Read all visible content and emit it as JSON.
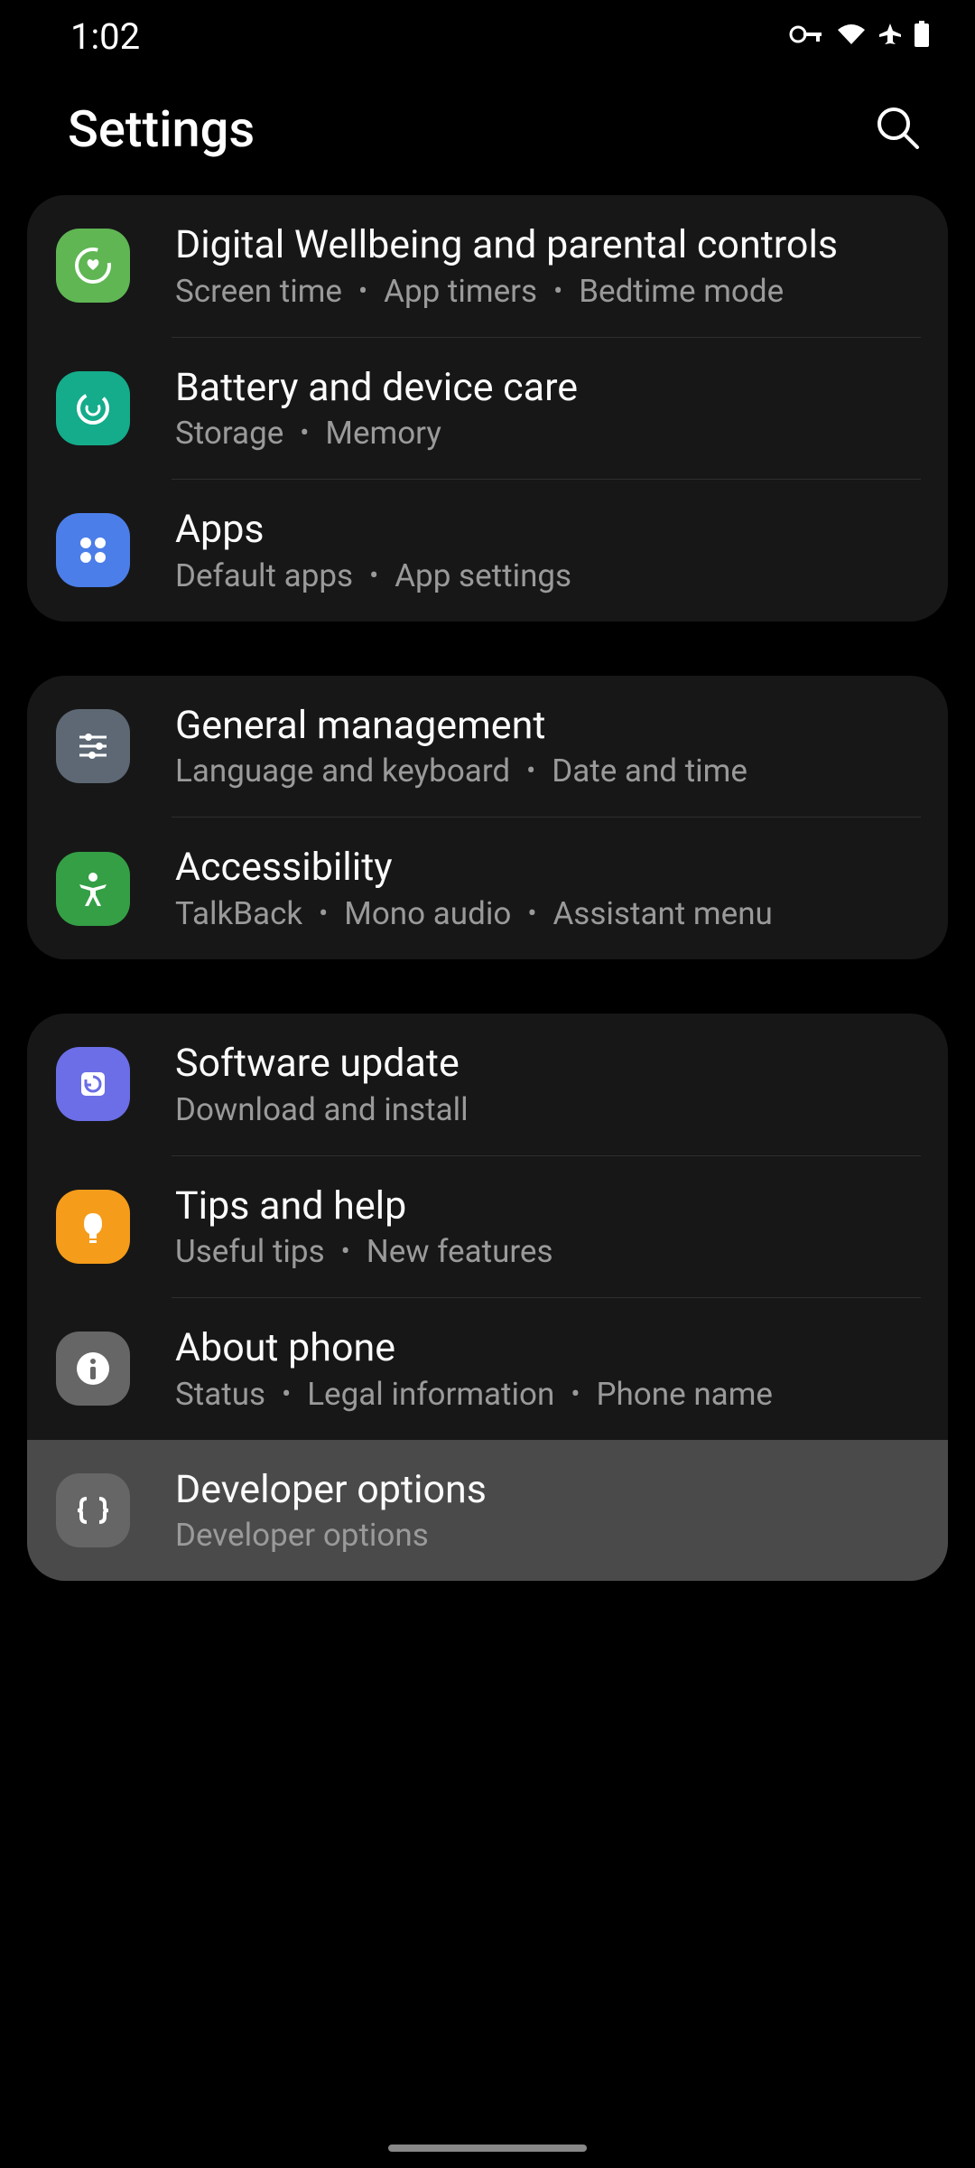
{
  "status": {
    "time": "1:02"
  },
  "header": {
    "title": "Settings"
  },
  "groups": [
    {
      "items": [
        {
          "id": "wellbeing",
          "title": "Digital Wellbeing and parental controls",
          "subs": [
            "Screen time",
            "App timers",
            "Bedtime mode"
          ],
          "iconBg": "#5fb653"
        },
        {
          "id": "battery",
          "title": "Battery and device care",
          "subs": [
            "Storage",
            "Memory"
          ],
          "iconBg": "#14ac8b"
        },
        {
          "id": "apps",
          "title": "Apps",
          "subs": [
            "Default apps",
            "App settings"
          ],
          "iconBg": "#4b7ee8"
        }
      ]
    },
    {
      "items": [
        {
          "id": "general",
          "title": "General management",
          "subs": [
            "Language and keyboard",
            "Date and time"
          ],
          "iconBg": "#5d6874"
        },
        {
          "id": "accessibility",
          "title": "Accessibility",
          "subs": [
            "TalkBack",
            "Mono audio",
            "Assistant menu"
          ],
          "iconBg": "#349f45"
        }
      ]
    },
    {
      "items": [
        {
          "id": "software",
          "title": "Software update",
          "subs": [
            "Download and install"
          ],
          "iconBg": "#6b6ee6"
        },
        {
          "id": "tips",
          "title": "Tips and help",
          "subs": [
            "Useful tips",
            "New features"
          ],
          "iconBg": "#f59c1a"
        },
        {
          "id": "about",
          "title": "About phone",
          "subs": [
            "Status",
            "Legal information",
            "Phone name"
          ],
          "iconBg": "#666666"
        },
        {
          "id": "developer",
          "title": "Developer options",
          "subs": [
            "Developer options"
          ],
          "iconBg": "#666666",
          "highlighted": true
        }
      ]
    }
  ]
}
